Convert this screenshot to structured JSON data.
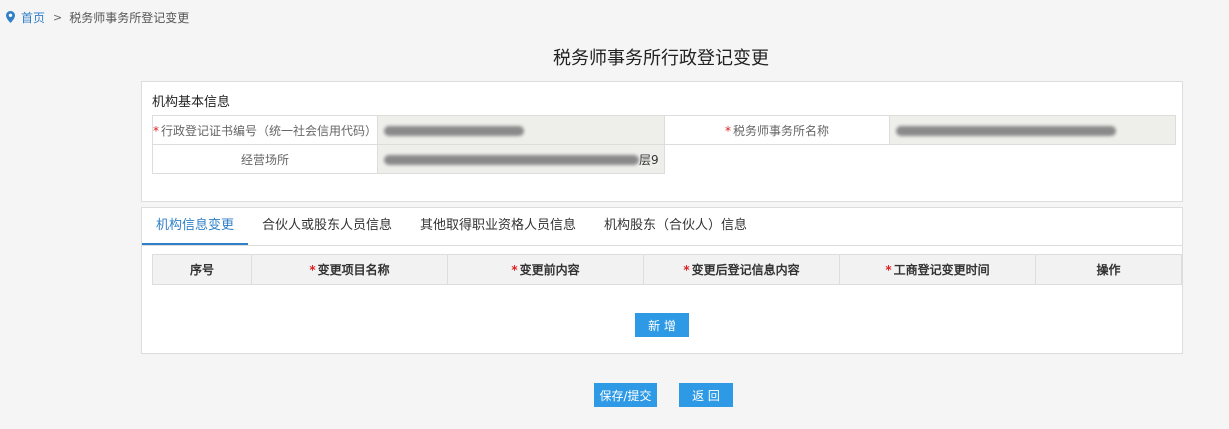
{
  "breadcrumb": {
    "home": "首页",
    "separator": ">",
    "current": "税务师事务所登记变更"
  },
  "page_title": "税务师事务所行政登记变更",
  "basic_info": {
    "section_title": "机构基本信息",
    "required_mark": "*",
    "reg_cert_label": "行政登记证书编号（统一社会信用代码）",
    "firm_name_label": "税务师事务所名称",
    "address_label": "经营场所",
    "address_value_suffix": "层9"
  },
  "tabs": [
    {
      "label": "机构信息变更",
      "active": true
    },
    {
      "label": "合伙人或股东人员信息",
      "active": false
    },
    {
      "label": "其他取得职业资格人员信息",
      "active": false
    },
    {
      "label": "机构股东（合伙人）信息",
      "active": false
    }
  ],
  "change_table": {
    "columns": [
      {
        "label": "序号",
        "required": false
      },
      {
        "label": "变更项目名称",
        "required": true
      },
      {
        "label": "变更前内容",
        "required": true
      },
      {
        "label": "变更后登记信息内容",
        "required": true
      },
      {
        "label": "工商登记变更时间",
        "required": true
      },
      {
        "label": "操作",
        "required": false
      }
    ],
    "add_button": "新 增"
  },
  "buttons": {
    "save": "保存/提交",
    "back": "返 回"
  },
  "colors": {
    "accent": "#2e9ae5",
    "link": "#2f7fc9",
    "required": "#e02020"
  }
}
